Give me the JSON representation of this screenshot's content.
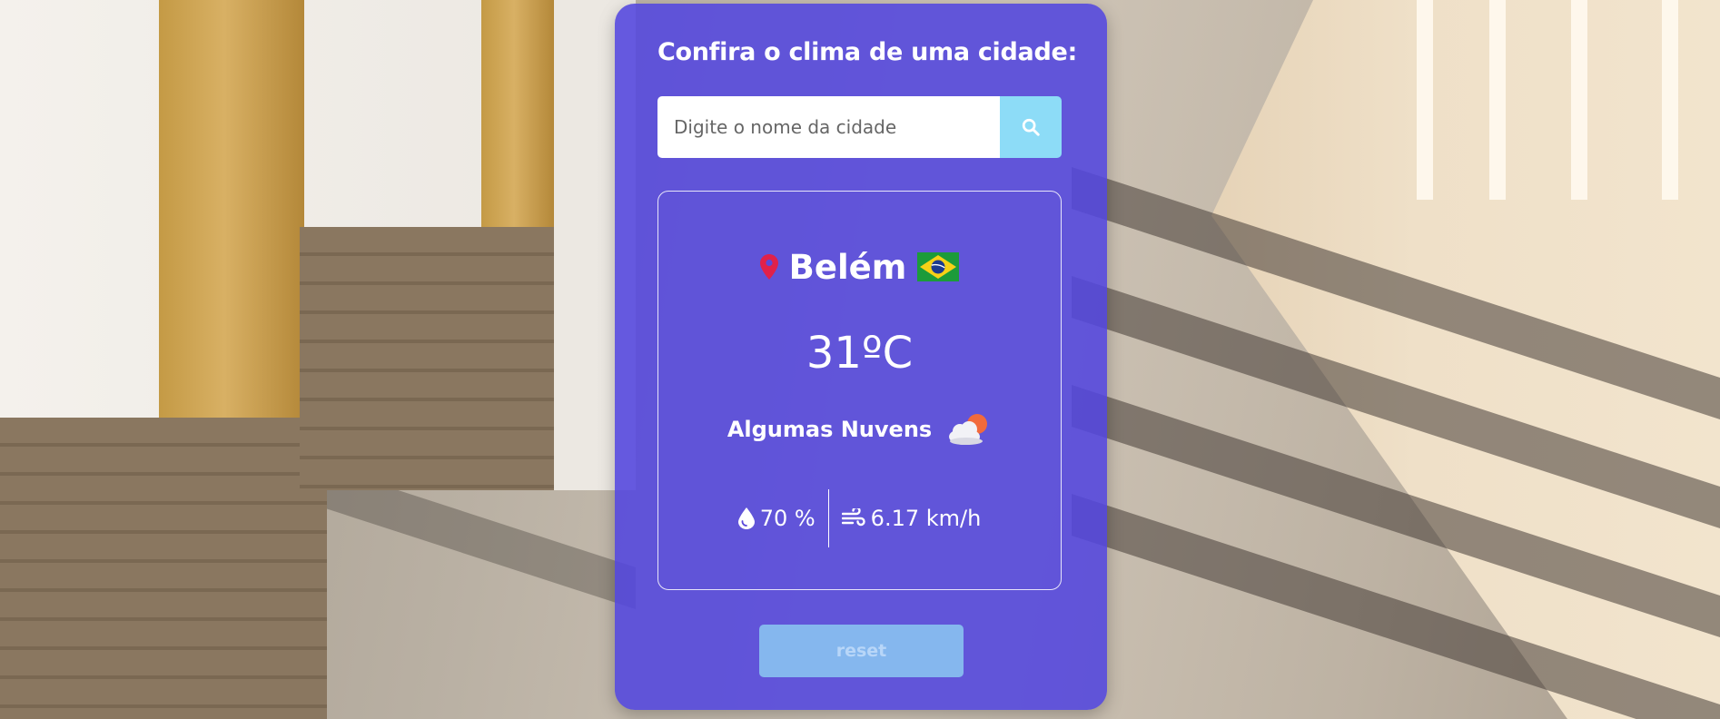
{
  "header": {
    "title": "Confira o clima de uma cidade:"
  },
  "search": {
    "placeholder": "Digite o nome da cidade",
    "value": ""
  },
  "weather": {
    "city": "Belém",
    "country_flag": "brazil-flag-icon",
    "temperature": "31ºC",
    "description": "Algumas Nuvens",
    "description_icon": "partly-cloudy-icon",
    "humidity": "70 %",
    "wind": "6.17 km/h"
  },
  "actions": {
    "reset_label": "reset"
  },
  "colors": {
    "card": "#5246de",
    "search_button": "#8ddcf7",
    "reset_button": "#85b7ee",
    "pin": "#e0214a"
  }
}
